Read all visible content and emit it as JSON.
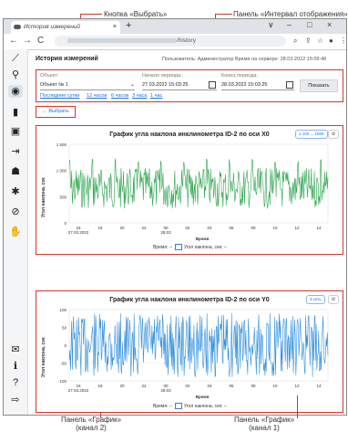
{
  "annotations": {
    "select_button": "Кнопка «Выбрать»",
    "interval_panel": "Панель «Интервал отображения»",
    "chart_panel_2": [
      "Панель «График»",
      "(канал 2)"
    ],
    "chart_panel_1": [
      "Панель «График»",
      "(канал 1)"
    ]
  },
  "browser": {
    "tab_title": "История измерений",
    "tab_close": "×",
    "new_tab": "+",
    "url_suffix": "/history",
    "window_controls": [
      "∨",
      "–",
      "□",
      "×"
    ]
  },
  "header": {
    "page_title": "История измерений",
    "user_info": "Пользователь: Администратор   Время на сервере: 28.03.2022 15:09:48"
  },
  "filter": {
    "object_label": "Объект:",
    "object_value": "Объект № 1",
    "start_label": "Начало периода:",
    "start_value": "27.03.2022 15:03:25",
    "end_label": "Конец периода:",
    "end_value": "28.03.2022 15:03:25",
    "show_button": "Показать",
    "quick_ranges": [
      "Последние сутки",
      "12 часов",
      "6 часов",
      "3 часа",
      "1 час"
    ]
  },
  "back_button": "← Выбрать",
  "charts": [
    {
      "title": "График угла наклона инклинометра ID-2 по оси X0",
      "range_button": "1 100 ... 1500",
      "ylabel": "Угол наклона, сек",
      "xlabel": "Время",
      "yticks": [
        "1 500",
        "1 000",
        "500",
        "0"
      ],
      "xticks": [
        "16",
        "18",
        "20",
        "22",
        "00",
        "02",
        "04",
        "06",
        "08",
        "10",
        "12",
        "14"
      ],
      "date_left": "27.03.2022",
      "date_mid": "28.03",
      "legend_time": "Время: --",
      "legend_series": "Угол наклона, сек: --",
      "color": "#2ea44f"
    },
    {
      "title": "График угла наклона инклинометра ID-2 по оси Y0",
      "range_button": "3 сеть",
      "ylabel": "Угол наклона, сек",
      "xlabel": "Время",
      "yticks": [
        "100",
        "50",
        "0",
        "-50",
        "-100"
      ],
      "xticks": [
        "16",
        "18",
        "20",
        "22",
        "00",
        "02",
        "04",
        "06",
        "08",
        "10",
        "12",
        "14"
      ],
      "date_left": "27.03.2022",
      "date_mid": "28.03",
      "legend_time": "Время: --",
      "legend_series": "Угол наклона, сек: --",
      "color": "#2f8fdc"
    }
  ]
}
